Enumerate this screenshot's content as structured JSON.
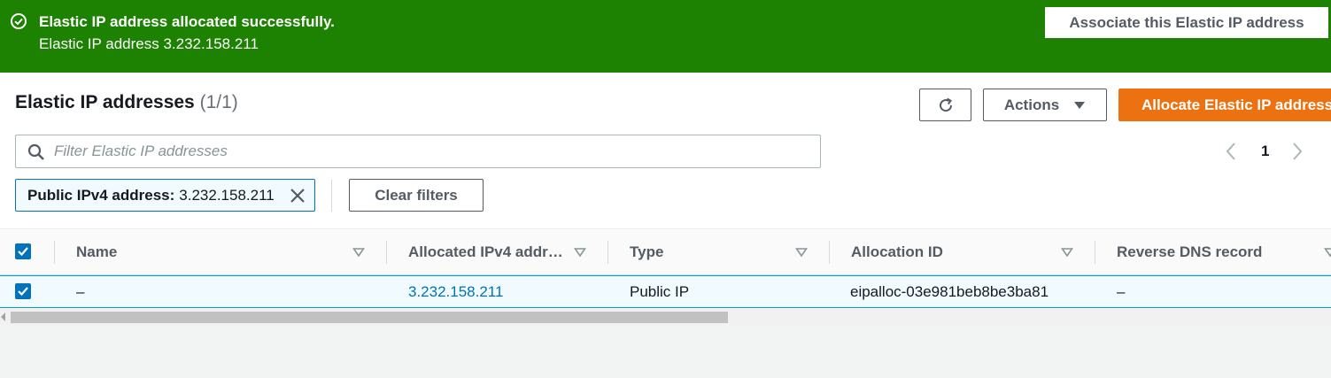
{
  "flash": {
    "title": "Elastic IP address allocated successfully.",
    "message": "Elastic IP address 3.232.158.211",
    "action_label": "Associate this Elastic IP address",
    "color": "#1d8102"
  },
  "header": {
    "title": "Elastic IP addresses",
    "count": "(1/1)",
    "actions_label": "Actions",
    "allocate_label": "Allocate Elastic IP address",
    "allocate_color": "#ec7211"
  },
  "search": {
    "placeholder": "Filter Elastic IP addresses",
    "value": ""
  },
  "pagination": {
    "current_page": "1"
  },
  "filter_token": {
    "key": "Public IPv4 address:",
    "value": "3.232.158.211"
  },
  "clear_filters_label": "Clear filters",
  "table": {
    "columns": [
      "Name",
      "Allocated IPv4 addr…",
      "Type",
      "Allocation ID",
      "Reverse DNS record"
    ],
    "rows": [
      {
        "selected": true,
        "name": "–",
        "allocated_ipv4": "3.232.158.211",
        "type": "Public IP",
        "allocation_id": "eipalloc-03e981beb8be3ba81",
        "reverse_dns": "–"
      }
    ]
  }
}
